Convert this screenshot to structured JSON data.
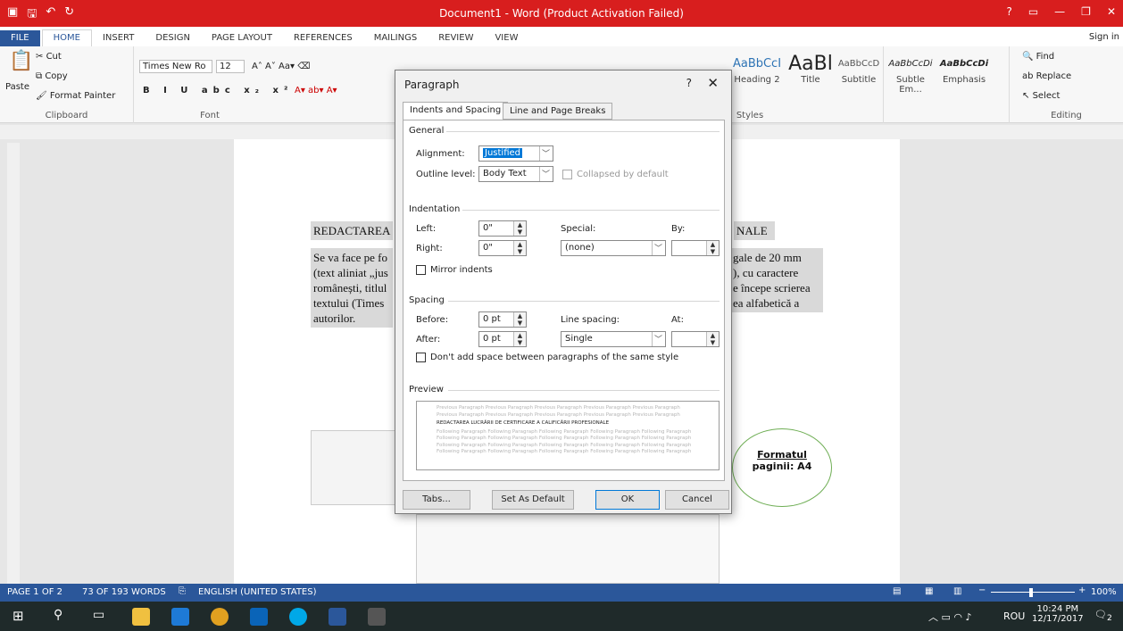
{
  "window": {
    "title": "Document1 - Word (Product Activation Failed)"
  },
  "ribbon_tabs": [
    "FILE",
    "HOME",
    "INSERT",
    "DESIGN",
    "PAGE LAYOUT",
    "REFERENCES",
    "MAILINGS",
    "REVIEW",
    "VIEW"
  ],
  "sign_in": "Sign in",
  "clipboard": {
    "paste": "Paste",
    "cut": "Cut",
    "copy": "Copy",
    "format_painter": "Format Painter",
    "label": "Clipboard"
  },
  "font": {
    "name": "Times New Ro",
    "size": "12",
    "label": "Font"
  },
  "styles": {
    "items": [
      {
        "preview": "AaBbCcI",
        "name": "Heading 2"
      },
      {
        "preview": "AaBl",
        "name": "Title"
      },
      {
        "preview": "AaBbCcD",
        "name": "Subtitle"
      },
      {
        "preview": "AaBbCcDi",
        "name": "Subtle Em..."
      },
      {
        "preview": "AaBbCcDi",
        "name": "Emphasis"
      }
    ],
    "label": "Styles"
  },
  "editing": {
    "find": "Find",
    "replace": "Replace",
    "select": "Select",
    "label": "Editing"
  },
  "document": {
    "heading_left": "REDACTAREA",
    "heading_right": "NALE",
    "body_left": [
      "Se va face pe fo",
      "(text aliniat „jus",
      "românești, titlul",
      "textului (Times",
      "autorilor."
    ],
    "body_right": [
      "gale de 20 mm",
      "), cu caractere",
      "e începe scrierea",
      "ea alfabetică a"
    ],
    "ellipse_text": [
      "Formatul",
      "paginii: A4"
    ]
  },
  "dialog": {
    "title": "Paragraph",
    "help": "?",
    "close": "✕",
    "tabs": [
      "Indents and Spacing",
      "Line and Page Breaks"
    ],
    "general": {
      "heading": "General",
      "alignment_label": "Alignment:",
      "alignment_value": "Justified",
      "outline_label": "Outline level:",
      "outline_value": "Body Text",
      "collapsed_label": "Collapsed by default"
    },
    "indentation": {
      "heading": "Indentation",
      "left_label": "Left:",
      "left_value": "0\"",
      "right_label": "Right:",
      "right_value": "0\"",
      "special_label": "Special:",
      "special_value": "(none)",
      "by_label": "By:",
      "mirror_label": "Mirror indents"
    },
    "spacing": {
      "heading": "Spacing",
      "before_label": "Before:",
      "before_value": "0 pt",
      "after_label": "After:",
      "after_value": "0 pt",
      "line_spacing_label": "Line spacing:",
      "line_spacing_value": "Single",
      "at_label": "At:",
      "dont_add_label": "Don't add space between paragraphs of the same style"
    },
    "preview": {
      "heading": "Preview",
      "previous": "Previous Paragraph Previous Paragraph Previous Paragraph Previous Paragraph Previous Paragraph",
      "current": "REDACTAREA LUCRĂRII DE CERTIFICARE A CALIFICĂRII PROFESIONALE",
      "following": "Following Paragraph Following Paragraph Following Paragraph Following Paragraph Following Paragraph"
    },
    "buttons": {
      "tabs": "Tabs...",
      "set_default": "Set As Default",
      "ok": "OK",
      "cancel": "Cancel"
    }
  },
  "status": {
    "page": "PAGE 1 OF 2",
    "words": "73 OF 193 WORDS",
    "language": "ENGLISH (UNITED STATES)",
    "zoom": "100%"
  },
  "taskbar": {
    "lang": "ROU",
    "time": "10:24 PM",
    "date": "12/17/2017",
    "notif": "2"
  }
}
